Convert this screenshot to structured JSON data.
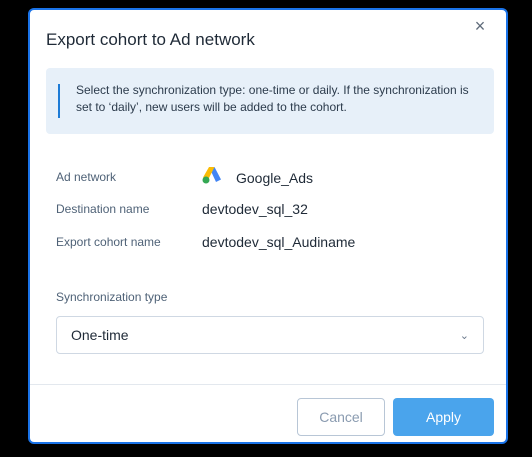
{
  "dialog": {
    "title": "Export cohort to Ad network",
    "close_glyph": "×",
    "info_text": "Select the synchronization type: one-time or daily. If the synchronization is set to ‘daily’, new users will be added to the cohort."
  },
  "fields": {
    "ad_network": {
      "label": "Ad network",
      "value": "Google_Ads",
      "icon": "google-ads-icon"
    },
    "destination_name": {
      "label": "Destination name",
      "value": "devtodev_sql_32"
    },
    "export_cohort_name": {
      "label": "Export cohort name",
      "value": "devtodev_sql_Audiname"
    }
  },
  "sync": {
    "label": "Synchronization type",
    "selected": "One-time"
  },
  "buttons": {
    "cancel": "Cancel",
    "apply": "Apply"
  },
  "colors": {
    "accent": "#4aa4ec",
    "info_bg": "#e7f0f9",
    "info_bar": "#1d7bd6"
  }
}
